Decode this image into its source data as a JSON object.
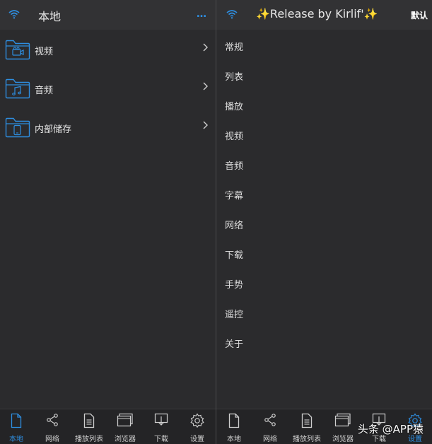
{
  "colors": {
    "accent": "#2e8ee0",
    "background": "#2b2b2d",
    "header": "#323234",
    "tabbar": "#242426"
  },
  "left": {
    "title": "本地",
    "more_icon": "…",
    "folders": [
      {
        "label": "视频",
        "icon": "video-folder-icon"
      },
      {
        "label": "音频",
        "icon": "audio-folder-icon"
      },
      {
        "label": "内部储存",
        "icon": "phone-folder-icon"
      }
    ]
  },
  "right": {
    "title": "✨Release by Kirlif'✨",
    "default_btn": "默认",
    "settings": [
      "常规",
      "列表",
      "播放",
      "视频",
      "音频",
      "字幕",
      "网络",
      "下载",
      "手势",
      "遥控",
      "关于"
    ]
  },
  "tabs": {
    "left": [
      "本地",
      "网络",
      "播放列表",
      "浏览器",
      "下载",
      "设置"
    ],
    "right": [
      "本地",
      "网络",
      "播放列表",
      "浏览器",
      "下载",
      "设置"
    ],
    "left_active": 0,
    "right_active": 5
  },
  "watermark": "头条 @APP猿"
}
